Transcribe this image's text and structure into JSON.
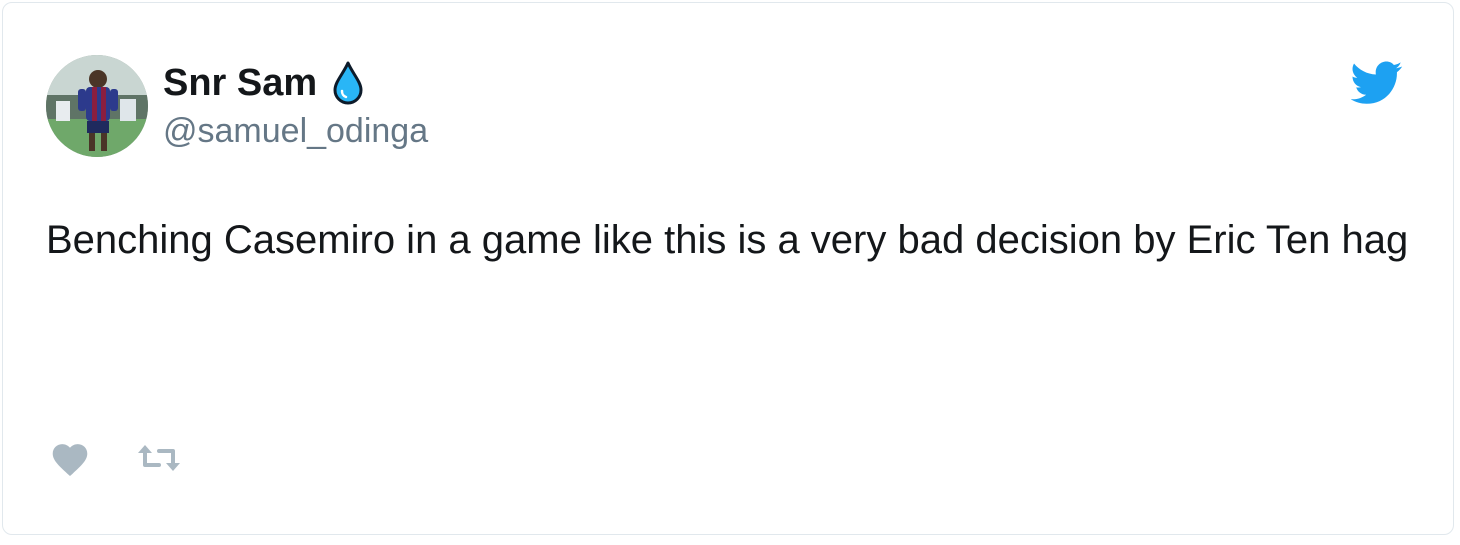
{
  "tweet": {
    "author": {
      "display_name": "Snr Sam",
      "handle": "@samuel_odinga",
      "avatar_icon": "avatar-photo",
      "name_emoji_icon": "droplet-icon"
    },
    "text": "Benching Casemiro in a game like this is a very bad decision by Eric Ten hag",
    "actions": [
      {
        "name": "like",
        "icon": "heart-icon"
      },
      {
        "name": "retweet",
        "icon": "retweet-icon"
      }
    ],
    "brand_icon": "twitter-bird-icon"
  },
  "colors": {
    "text_primary": "#14171a",
    "text_secondary": "#657786",
    "twitter_blue": "#1da1f2",
    "icon_gray": "#aab8c2",
    "border": "#e1e8ed",
    "droplet": "#29b6f6"
  }
}
